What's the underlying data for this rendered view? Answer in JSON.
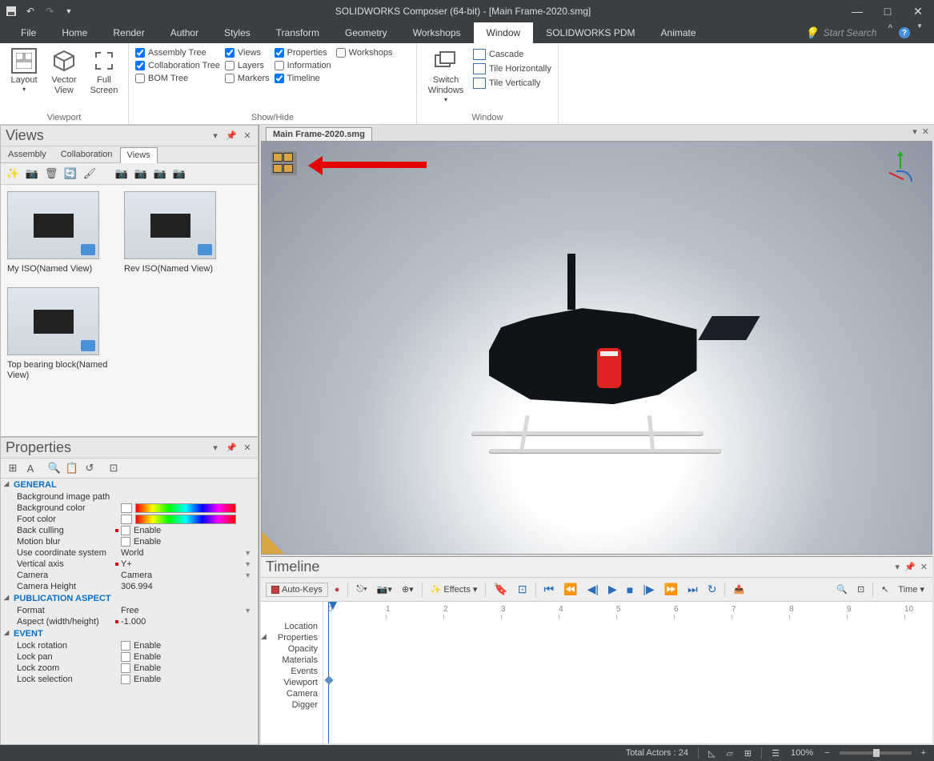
{
  "app_title": "SOLIDWORKS Composer (64-bit) - [Main Frame-2020.smg]",
  "search_placeholder": "Start Search",
  "menu": [
    "File",
    "Home",
    "Render",
    "Author",
    "Styles",
    "Transform",
    "Geometry",
    "Workshops",
    "Window",
    "SOLIDWORKS PDM",
    "Animate"
  ],
  "active_menu": "Window",
  "ribbon": {
    "viewport": {
      "label": "Viewport",
      "layout": "Layout",
      "vector": "Vector\nView",
      "full": "Full\nScreen"
    },
    "showhide": {
      "label": "Show/Hide",
      "col1": [
        {
          "label": "Assembly Tree",
          "checked": true
        },
        {
          "label": "Collaboration Tree",
          "checked": true
        },
        {
          "label": "BOM Tree",
          "checked": false
        }
      ],
      "col2": [
        {
          "label": "Views",
          "checked": true
        },
        {
          "label": "Layers",
          "checked": false
        },
        {
          "label": "Markers",
          "checked": false
        }
      ],
      "col3": [
        {
          "label": "Properties",
          "checked": true
        },
        {
          "label": "Information",
          "checked": false
        },
        {
          "label": "Timeline",
          "checked": true
        }
      ],
      "col4": [
        {
          "label": "Workshops",
          "checked": false
        }
      ]
    },
    "window": {
      "label": "Window",
      "switch": "Switch\nWindows",
      "items": [
        "Cascade",
        "Tile Horizontally",
        "Tile Vertically"
      ]
    }
  },
  "views_panel": {
    "title": "Views",
    "tabs": [
      "Assembly",
      "Collaboration",
      "Views"
    ],
    "active_tab": "Views",
    "thumbs": [
      {
        "label": "My ISO(Named View)"
      },
      {
        "label": "Rev ISO(Named View)"
      },
      {
        "label": "Top bearing block(Named View)"
      }
    ]
  },
  "properties_panel": {
    "title": "Properties",
    "groups": {
      "general": {
        "title": "GENERAL",
        "rows": [
          {
            "k": "Background image path",
            "v": ""
          },
          {
            "k": "Background color",
            "v": "",
            "rainbow": true,
            "swatch": true
          },
          {
            "k": "Foot color",
            "v": "",
            "rainbow": true,
            "swatch": true
          },
          {
            "k": "Back culling",
            "v": "Enable",
            "check": true,
            "dot": true
          },
          {
            "k": "Motion blur",
            "v": "Enable",
            "check": true
          },
          {
            "k": "Use coordinate system",
            "v": "World",
            "dd": true
          },
          {
            "k": "Vertical axis",
            "v": "Y+",
            "dot": true,
            "dd": true
          },
          {
            "k": "Camera",
            "v": "Camera",
            "dd": true
          },
          {
            "k": "Camera Height",
            "v": "306.994"
          }
        ]
      },
      "pub": {
        "title": "PUBLICATION ASPECT",
        "rows": [
          {
            "k": "Format",
            "v": "Free",
            "dd": true
          },
          {
            "k": "Aspect (width/height)",
            "v": "-1.000",
            "dot": true
          }
        ]
      },
      "event": {
        "title": "EVENT",
        "rows": [
          {
            "k": "Lock rotation",
            "v": "Enable",
            "check": true
          },
          {
            "k": "Lock pan",
            "v": "Enable",
            "check": true
          },
          {
            "k": "Lock zoom",
            "v": "Enable",
            "check": true
          },
          {
            "k": "Lock selection",
            "v": "Enable",
            "check": true
          }
        ]
      }
    }
  },
  "doc_tab": "Main Frame-2020.smg",
  "timeline": {
    "title": "Timeline",
    "auto_keys": "Auto-Keys",
    "effects": "Effects",
    "time": "Time",
    "tracks": [
      "Location",
      "Properties",
      "Opacity",
      "Materials",
      "Events",
      "Viewport",
      "Camera",
      "Digger"
    ],
    "ticks": [
      "0",
      "1",
      "2",
      "3",
      "4",
      "5",
      "6",
      "7",
      "8",
      "9",
      "10"
    ]
  },
  "status": {
    "actors": "Total Actors : 24",
    "zoom": "100%"
  }
}
